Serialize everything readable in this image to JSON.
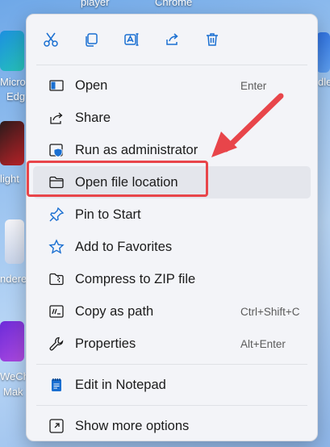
{
  "desktop": {
    "labels": [
      "player",
      "Chrome",
      "Micro",
      "Edg",
      "light",
      "nderel",
      "WeCh",
      "Mak",
      "dle"
    ]
  },
  "quick_actions": [
    {
      "name": "cut-icon"
    },
    {
      "name": "copy-icon"
    },
    {
      "name": "rename-icon"
    },
    {
      "name": "share-icon"
    },
    {
      "name": "delete-icon"
    }
  ],
  "menu": {
    "items": [
      {
        "label": "Open",
        "shortcut": "Enter",
        "icon": "open-icon"
      },
      {
        "label": "Share",
        "shortcut": "",
        "icon": "share-icon"
      },
      {
        "label": "Run as administrator",
        "shortcut": "",
        "icon": "shield-icon"
      },
      {
        "label": "Open file location",
        "shortcut": "",
        "icon": "folder-icon"
      },
      {
        "label": "Pin to Start",
        "shortcut": "",
        "icon": "pin-icon"
      },
      {
        "label": "Add to Favorites",
        "shortcut": "",
        "icon": "star-icon"
      },
      {
        "label": "Compress to ZIP file",
        "shortcut": "",
        "icon": "zip-icon"
      },
      {
        "label": "Copy as path",
        "shortcut": "Ctrl+Shift+C",
        "icon": "copy-path-icon"
      },
      {
        "label": "Properties",
        "shortcut": "Alt+Enter",
        "icon": "wrench-icon"
      }
    ],
    "notepad": {
      "label": "Edit in Notepad",
      "icon": "notepad-icon"
    },
    "more": {
      "label": "Show more options",
      "icon": "more-options-icon"
    }
  },
  "annotation": {
    "highlight_color": "#e8454a",
    "highlighted_item": "Open file location"
  },
  "colors": {
    "menu_bg": "#f3f4f8",
    "accent": "#1a6fd1"
  }
}
